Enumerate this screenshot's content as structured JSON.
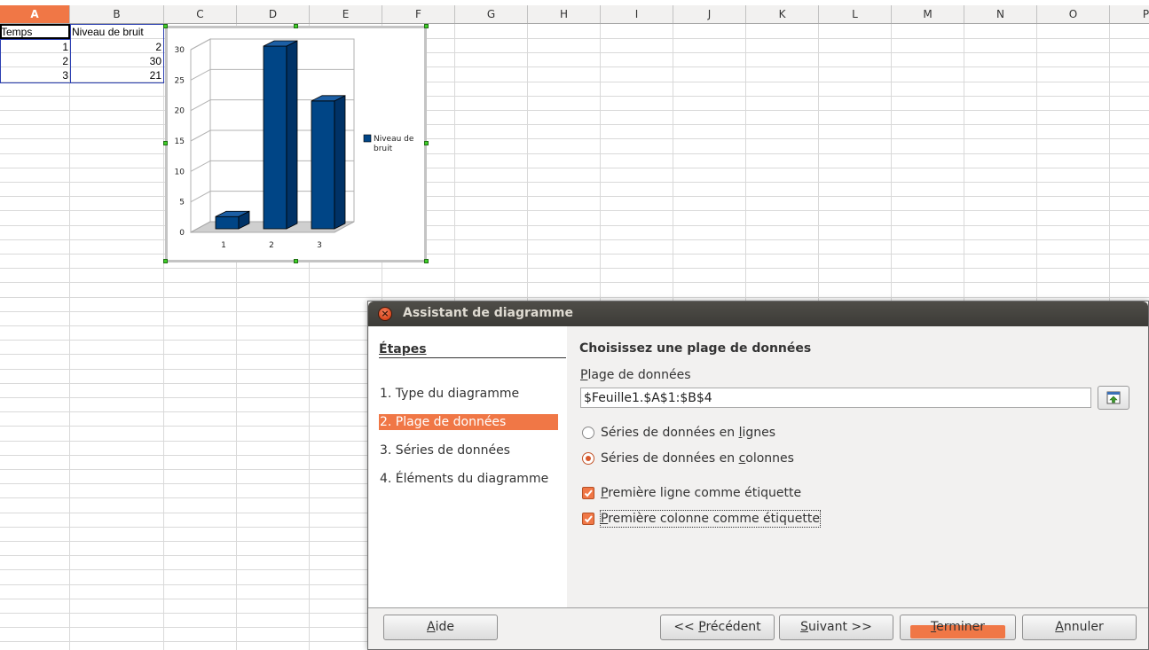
{
  "spreadsheet": {
    "columns": [
      "A",
      "B",
      "C",
      "D",
      "E",
      "F",
      "G",
      "H",
      "I",
      "J",
      "K",
      "L",
      "M",
      "N",
      "O",
      "P"
    ],
    "active_column": "A",
    "cells": {
      "A1": "Temps",
      "B1": "Niveau de bruit",
      "A2": "1",
      "B2": "2",
      "A3": "2",
      "B3": "30",
      "A4": "3",
      "B4": "21"
    }
  },
  "chart_data": {
    "type": "bar",
    "categories": [
      "1",
      "2",
      "3"
    ],
    "series": [
      {
        "name": "Niveau de bruit",
        "values": [
          2,
          30,
          21
        ]
      }
    ],
    "title": "",
    "xlabel": "",
    "ylabel": "",
    "ylim": [
      0,
      30
    ],
    "yticks": [
      "0",
      "5",
      "10",
      "15",
      "20",
      "25",
      "30"
    ],
    "grid": true,
    "legend_position": "right",
    "three_d": true,
    "colors": {
      "bar": "#004586",
      "bar_side": "#003266",
      "bar_top": "#1c5fa5"
    },
    "legend": {
      "line1": "Niveau de",
      "line2": "bruit"
    }
  },
  "dialog": {
    "title": "Assistant de diagramme",
    "close_icon": "close-icon",
    "steps_heading": "Étapes",
    "steps": [
      "1. Type du diagramme",
      "2. Plage de données",
      "3. Séries de données",
      "4. Éléments du diagramme"
    ],
    "active_step": 1,
    "section_title": "Choisissez une plage de données",
    "range_label": "Plage de données",
    "range_value": "$Feuille1.$A$1:$B$4",
    "range_button_icon": "shrink-selection-icon",
    "radio_rows": "Séries de données en lignes",
    "radio_columns": "Séries de données en colonnes",
    "radio_selected": "columns",
    "check_first_row": "Première ligne comme étiquette",
    "check_first_col": "Première colonne comme étiquette",
    "buttons": {
      "help": "Aide",
      "back": "<< Précédent",
      "next": "Suivant >>",
      "finish": "Terminer",
      "cancel": "Annuler"
    },
    "accent_color": "#f07746"
  }
}
